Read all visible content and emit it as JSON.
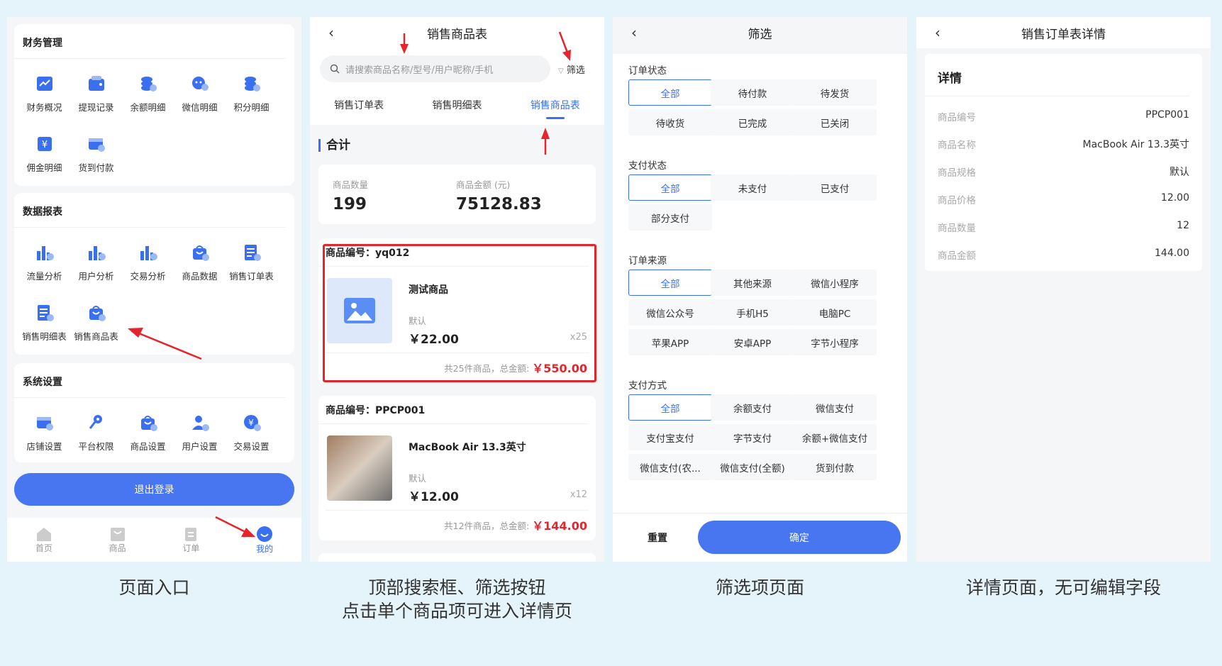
{
  "colors": {
    "accent": "#3a6ff0",
    "button": "#4876f0",
    "alert_red": "#e5242b",
    "page_bg": "#e5f3fa"
  },
  "panel1": {
    "finance": {
      "title": "财务管理",
      "items": [
        {
          "label": "财务概况",
          "icon": "chart-line-icon"
        },
        {
          "label": "提现记录",
          "icon": "wallet-icon"
        },
        {
          "label": "余额明细",
          "icon": "coins-icon"
        },
        {
          "label": "微信明细",
          "icon": "wechat-icon"
        },
        {
          "label": "积分明细",
          "icon": "points-icon"
        },
        {
          "label": "佣金明细",
          "icon": "yen-icon"
        },
        {
          "label": "货到付款",
          "icon": "truck-icon"
        }
      ]
    },
    "reports": {
      "title": "数据报表",
      "items": [
        {
          "label": "流量分析",
          "icon": "bar-chart-icon"
        },
        {
          "label": "用户分析",
          "icon": "user-chart-icon"
        },
        {
          "label": "交易分析",
          "icon": "trade-chart-icon"
        },
        {
          "label": "商品数据",
          "icon": "bag-chart-icon"
        },
        {
          "label": "销售订单表",
          "icon": "order-doc-icon"
        },
        {
          "label": "销售明细表",
          "icon": "detail-doc-icon"
        },
        {
          "label": "销售商品表",
          "icon": "shopping-bag-icon"
        }
      ]
    },
    "settings": {
      "title": "系统设置",
      "items": [
        {
          "label": "店铺设置",
          "icon": "store-icon"
        },
        {
          "label": "平台权限",
          "icon": "key-icon"
        },
        {
          "label": "商品设置",
          "icon": "bag-settings-icon"
        },
        {
          "label": "用户设置",
          "icon": "user-settings-icon"
        },
        {
          "label": "交易设置",
          "icon": "yen-settings-icon"
        }
      ]
    },
    "logout": "退出登录",
    "tabbar": [
      {
        "label": "首页",
        "icon": "home-icon"
      },
      {
        "label": "商品",
        "icon": "goods-icon"
      },
      {
        "label": "订单",
        "icon": "order-icon"
      },
      {
        "label": "我的",
        "icon": "profile-icon"
      }
    ]
  },
  "panel2": {
    "title": "销售商品表",
    "search_placeholder": "请搜索商品名称/型号/用户昵称/手机",
    "filter_label": "筛选",
    "tabs": [
      "销售订单表",
      "销售明细表",
      "销售商品表"
    ],
    "summary_title": "合计",
    "summary": {
      "qty_label": "商品数量",
      "qty": "199",
      "amount_label": "商品金额 (元)",
      "amount": "75128.83"
    },
    "orders": [
      {
        "code": "商品编号：yq012",
        "name": "测试商品",
        "spec": "默认",
        "price": "￥22.00",
        "qty": "x25",
        "foot": "共25件商品，总金额:",
        "total": "￥550.00"
      },
      {
        "code": "商品编号：PPCP001",
        "name": "MacBook Air 13.3英寸",
        "spec": "默认",
        "price": "￥12.00",
        "qty": "x12",
        "foot": "共12件商品，总金额:",
        "total": "￥144.00"
      }
    ]
  },
  "panel3": {
    "title": "筛选",
    "sections": [
      {
        "title": "订单状态",
        "options": [
          "全部",
          "待付款",
          "待发货",
          "待收货",
          "已完成",
          "已关闭"
        ]
      },
      {
        "title": "支付状态",
        "options": [
          "全部",
          "未支付",
          "已支付",
          "部分支付"
        ]
      },
      {
        "title": "订单来源",
        "options": [
          "全部",
          "其他来源",
          "微信小程序",
          "微信公众号",
          "手机H5",
          "电脑PC",
          "苹果APP",
          "安卓APP",
          "字节小程序"
        ]
      },
      {
        "title": "支付方式",
        "options": [
          "全部",
          "余额支付",
          "微信支付",
          "支付宝支付",
          "字节支付",
          "余额+微信支付",
          "微信支付(农...",
          "微信支付(全额)",
          "货到付款"
        ]
      }
    ],
    "reset": "重置",
    "confirm": "确定"
  },
  "panel4": {
    "title": "销售订单表详情",
    "card_title": "详情",
    "rows": [
      {
        "k": "商品编号",
        "v": "PPCP001"
      },
      {
        "k": "商品名称",
        "v": "MacBook Air 13.3英寸"
      },
      {
        "k": "商品规格",
        "v": "默认"
      },
      {
        "k": "商品价格",
        "v": "12.00"
      },
      {
        "k": "商品数量",
        "v": "12"
      },
      {
        "k": "商品金额",
        "v": "144.00"
      }
    ]
  },
  "captions": {
    "c1": "页面入口",
    "c2a": "顶部搜索框、筛选按钮",
    "c2b": "点击单个商品项可进入详情页",
    "c3": "筛选项页面",
    "c4": "详情页面，无可编辑字段"
  }
}
